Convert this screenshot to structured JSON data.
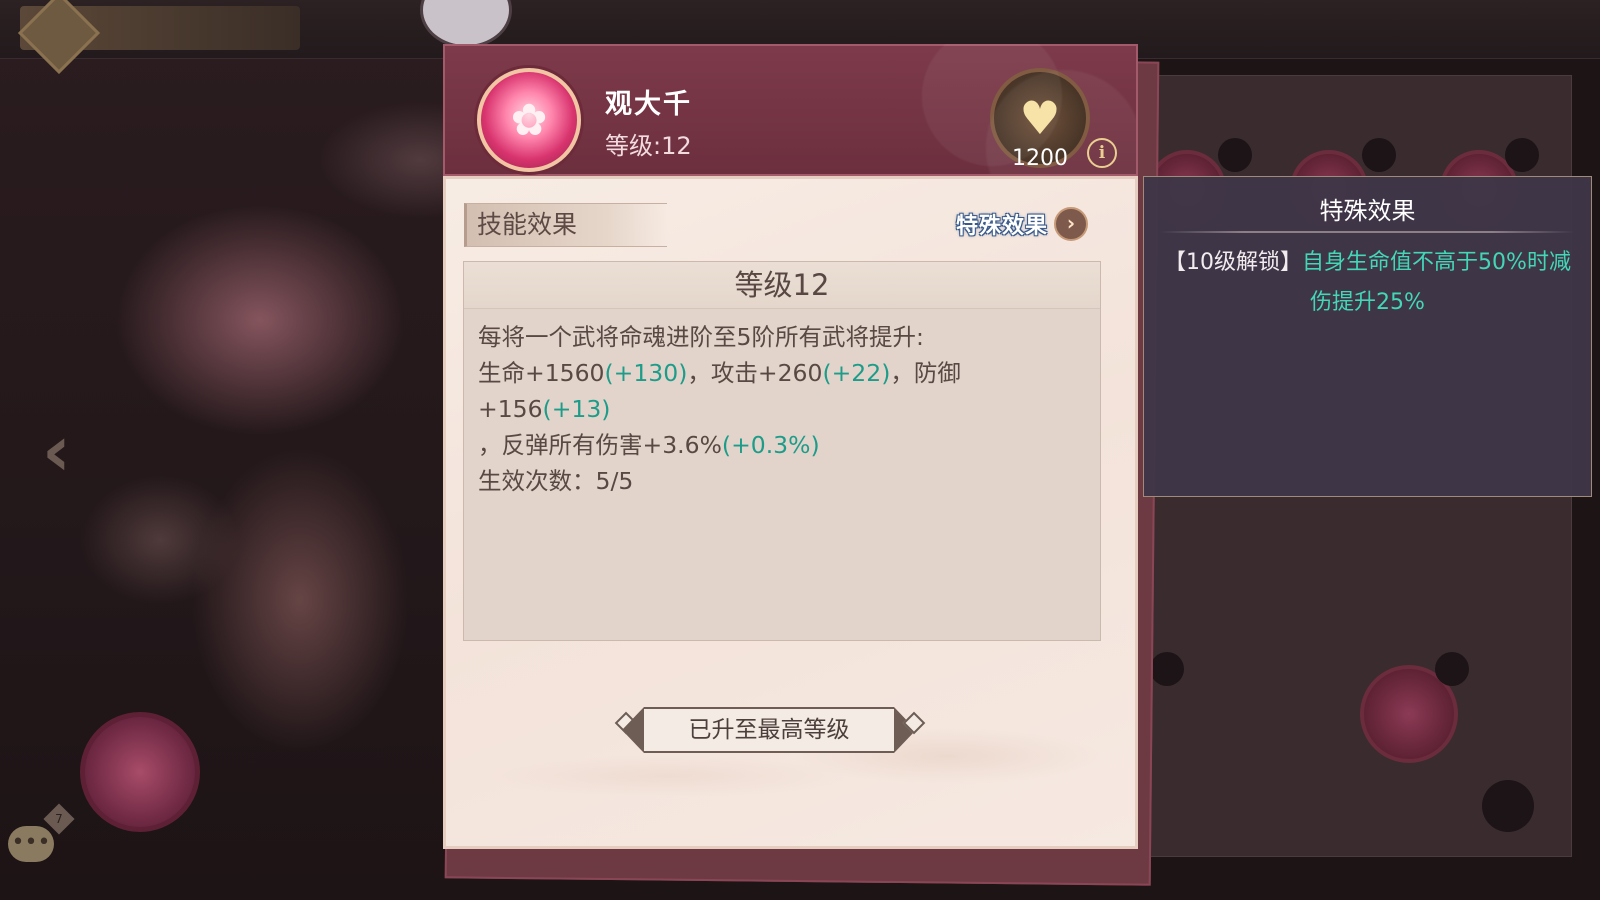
{
  "skill": {
    "name": "观大千",
    "level_label": "等级:12"
  },
  "power": {
    "value": "1200",
    "icon": "hands-heart-icon"
  },
  "tabs": {
    "skill_effect": "技能效果",
    "special_effect": "特殊效果"
  },
  "effect": {
    "level_title": "等级12",
    "line1": "每将一个武将命魂进阶至5阶所有武将提升:",
    "hp_text": "生命+1560",
    "hp_bonus": "(+130)",
    "sep1": "，攻击+260",
    "atk_bonus": "(+22)",
    "sep2": "，防御+156",
    "def_bonus": "(+13)",
    "reflect_text": "，反弹所有伤害+3.6%",
    "reflect_bonus": "(+0.3%)",
    "count_text": "生效次数：5/5"
  },
  "max_level_text": "已升至最高等级",
  "tooltip": {
    "title": "特殊效果",
    "unlock_tag": "【10级解锁】",
    "description": "自身生命值不高于50%时减伤提升25%"
  },
  "background": {
    "chat_badge_count": "7"
  },
  "colors": {
    "accent_green": "#1e9c8a",
    "tooltip_teal": "#43d6b7",
    "header_wine": "#7d3a4a"
  }
}
